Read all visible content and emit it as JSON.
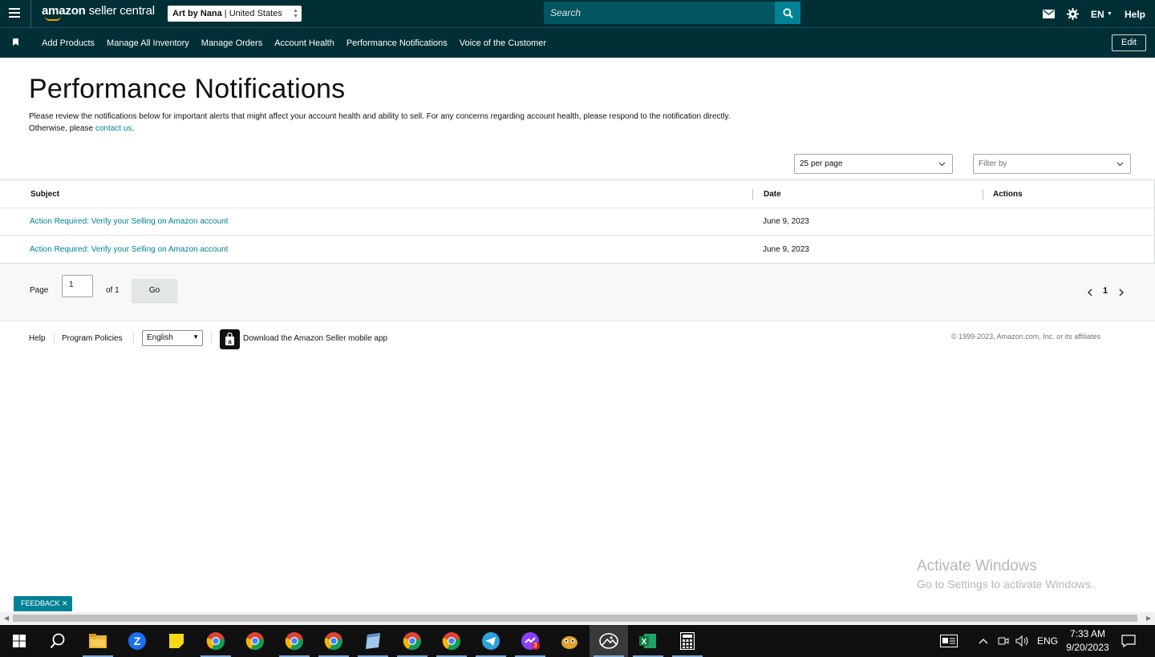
{
  "topbar": {
    "logo_main": "amazon",
    "logo_sub": "seller central",
    "store_name": "Art by Nana",
    "store_region": "United States",
    "search_placeholder": "Search",
    "language": "EN",
    "help": "Help"
  },
  "nav": {
    "items": [
      {
        "label": "Add Products"
      },
      {
        "label": "Manage All Inventory"
      },
      {
        "label": "Manage Orders"
      },
      {
        "label": "Account Health"
      },
      {
        "label": "Performance Notifications"
      },
      {
        "label": "Voice of the Customer"
      }
    ],
    "edit": "Edit"
  },
  "page": {
    "title": "Performance Notifications",
    "intro_line1": "Please review the notifications below for important alerts that might affect your account health and ability to sell. For any concerns regarding account health, please respond to the notification directly.",
    "intro_line2_prefix": "Otherwise, please ",
    "intro_link": "contact us",
    "intro_line2_suffix": "."
  },
  "controls": {
    "per_page": "25 per page",
    "filter_placeholder": "Filter by"
  },
  "table": {
    "columns": {
      "subject": "Subject",
      "date": "Date",
      "actions": "Actions"
    },
    "rows": [
      {
        "subject": "Action Required: Verify your Selling on Amazon account",
        "date": "June 9, 2023"
      },
      {
        "subject": "Action Required: Verify your Selling on Amazon account",
        "date": "June 9, 2023"
      }
    ]
  },
  "pagination": {
    "page_label": "Page",
    "page_value": "1",
    "of_label": "of 1",
    "go": "Go",
    "current": "1"
  },
  "footer": {
    "help": "Help",
    "program_policies": "Program Policies",
    "language": "English",
    "download_app": "Download the Amazon Seller mobile app",
    "copyright": "© 1999-2023, Amazon.com, Inc. or its affiliates"
  },
  "watermark": {
    "line1": "Activate Windows",
    "line2": "Go to Settings to activate Windows."
  },
  "feedback": "FEEDBACK",
  "taskbar": {
    "apps": [
      "start-icon",
      "search-icon",
      "file-explorer-icon",
      "zalo-icon",
      "sticky-notes-icon",
      "chrome-icon",
      "chrome-icon",
      "chrome-icon",
      "chrome-icon",
      "notepad-icon",
      "chrome-icon",
      "chrome-icon",
      "telegram-icon",
      "messenger-icon",
      "app-icon",
      "photos-icon",
      "excel-icon",
      "calculator-icon"
    ],
    "messenger_badge": "3",
    "input_lang": "ENG",
    "time": "7:33 AM",
    "date": "9/20/2023"
  },
  "colors": {
    "header_bg": "#002f36",
    "accent": "#008296",
    "search_bg": "#005561"
  }
}
